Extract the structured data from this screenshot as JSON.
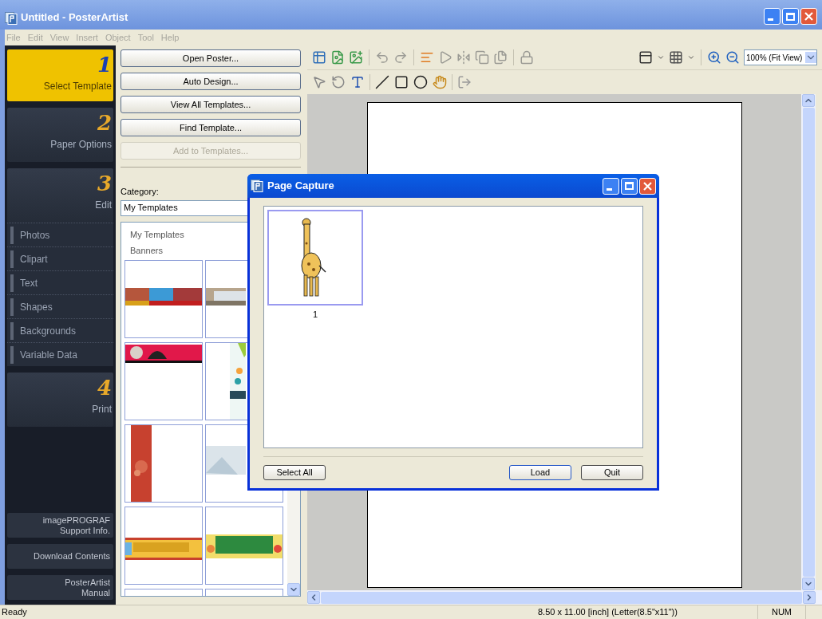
{
  "window": {
    "title": "Untitled - PosterArtist"
  },
  "menu": [
    "File",
    "Edit",
    "View",
    "Insert",
    "Object",
    "Tool",
    "Help"
  ],
  "steps": [
    {
      "number": "1",
      "label": "Select Template",
      "selected": true
    },
    {
      "number": "2",
      "label": "Paper Options",
      "selected": false
    },
    {
      "number": "3",
      "label": "Edit",
      "selected": false,
      "children": [
        "Photos",
        "Clipart",
        "Text",
        "Shapes",
        "Backgrounds",
        "Variable Data"
      ]
    },
    {
      "number": "4",
      "label": "Print",
      "selected": false
    }
  ],
  "links": [
    "imagePROGRAF\nSupport Info.",
    "Download Contents",
    "PosterArtist\nManual"
  ],
  "template_buttons": [
    {
      "label": "Open Poster...",
      "disabled": false
    },
    {
      "label": "Auto Design...",
      "disabled": false
    },
    {
      "label": "View All Templates...",
      "disabled": false
    },
    {
      "label": "Find Template...",
      "disabled": false
    },
    {
      "label": "Add to Templates...",
      "disabled": true
    }
  ],
  "category": {
    "label": "Category:",
    "value": "My Templates"
  },
  "template_tree": [
    "My Templates",
    "Banners"
  ],
  "thumbnails": [
    {
      "kind": "picture"
    },
    {
      "kind": "picture"
    },
    {
      "kind": "picture"
    },
    {
      "kind": "picture"
    },
    {
      "kind": "picture"
    },
    {
      "kind": "picture"
    },
    {
      "kind": "picture"
    },
    {
      "kind": "picture"
    },
    {
      "kind": "empty"
    },
    {
      "kind": "empty"
    }
  ],
  "zoom": {
    "value": "100% (Fit View)"
  },
  "dialog": {
    "title": "Page Capture",
    "pages": [
      {
        "label": "1",
        "selected": true
      }
    ],
    "buttons": [
      {
        "label": "Select All",
        "default": false
      },
      {
        "label": "Load",
        "default": true
      },
      {
        "label": "Quit",
        "default": false
      }
    ]
  },
  "status_bar": {
    "message": "Ready",
    "paper": "8.50 x 11.00 [inch] (Letter(8.5\"x11\"))",
    "num": "NUM"
  }
}
